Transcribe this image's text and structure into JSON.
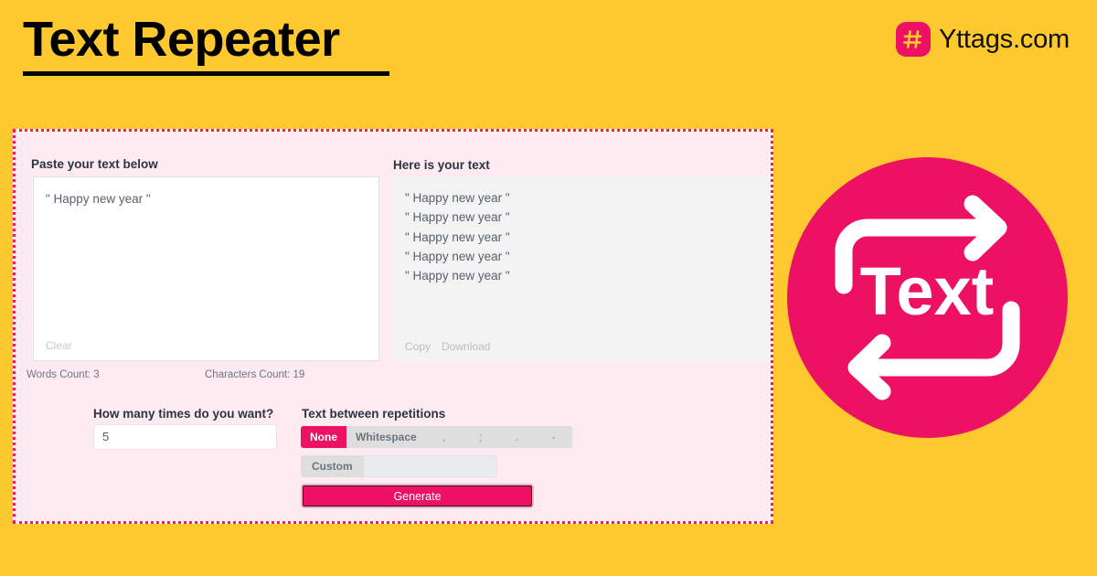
{
  "header": {
    "title": "Text Repeater",
    "brand_name": "Yttags.com",
    "brand_icon": "hashtag-icon"
  },
  "colors": {
    "background_yellow": "#FEC82F",
    "accent_pink": "#ED1164",
    "card_background": "#FDEBF1",
    "card_border": "#F51B5F",
    "output_background": "#F3F3F3",
    "text_dark": "#2b3445",
    "text_muted": "#6b7684"
  },
  "card": {
    "input_panel": {
      "label": "Paste your text below",
      "value": "\" Happy new year \"",
      "clear_label": "Clear"
    },
    "output_panel": {
      "label": "Here is your text",
      "lines": [
        "\" Happy new year \"",
        "\" Happy new year \"",
        "\" Happy new year \"",
        "\" Happy new year \"",
        "\" Happy new year \""
      ],
      "copy_label": "Copy",
      "download_label": "Download"
    },
    "counts": {
      "words": "Words Count: 3",
      "characters": "Characters Count: 19"
    },
    "controls": {
      "times_label": "How many times do you want?",
      "times_value": "5",
      "separator_label": "Text between repetitions",
      "separator_options": [
        {
          "label": "None",
          "active": true
        },
        {
          "label": "Whitespace",
          "active": false
        },
        {
          "label": ",",
          "active": false
        },
        {
          "label": ";",
          "active": false
        },
        {
          "label": ".",
          "active": false
        },
        {
          "label": "-",
          "active": false
        }
      ],
      "custom_label": "Custom",
      "custom_value": "",
      "custom_placeholder": "",
      "generate_label": "Generate"
    }
  },
  "graphic": {
    "icon_name": "repeat-text-icon",
    "center_label": "Text"
  }
}
